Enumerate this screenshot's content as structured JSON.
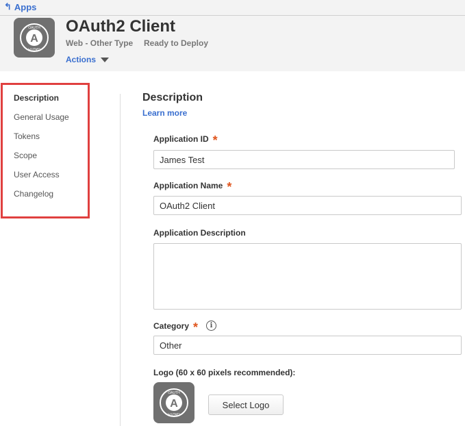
{
  "header": {
    "back_label": "Apps",
    "app_title": "OAuth2 Client",
    "app_type": "Web - Other Type",
    "status": "Ready to Deploy",
    "actions_label": "Actions",
    "icon_ring_text": "OAUTH"
  },
  "sidebar": {
    "items": [
      {
        "label": "Description",
        "active": true
      },
      {
        "label": "General Usage"
      },
      {
        "label": "Tokens"
      },
      {
        "label": "Scope"
      },
      {
        "label": "User Access"
      },
      {
        "label": "Changelog"
      }
    ]
  },
  "form": {
    "section_title": "Description",
    "learn_more": "Learn more",
    "required_marker": "*",
    "app_id_label": "Application ID",
    "app_id_value": "James Test",
    "app_name_label": "Application Name",
    "app_name_value": "OAuth2 Client",
    "app_desc_label": "Application Description",
    "app_desc_value": "",
    "category_label": "Category",
    "category_value": "Other",
    "logo_label": "Logo (60 x 60 pixels recommended):",
    "select_logo_button": "Select Logo"
  },
  "colors": {
    "link": "#3a6fcf",
    "required": "#e0561f",
    "highlight_box": "#e0403f",
    "icon_bg": "#707070"
  }
}
